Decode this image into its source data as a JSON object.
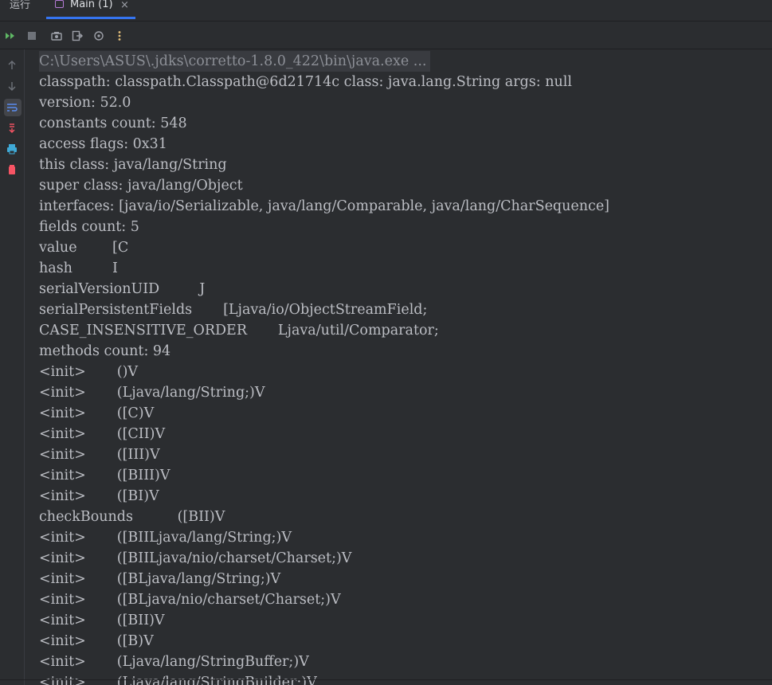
{
  "tabs": {
    "run_label": "运行",
    "main_label": "Main (1)",
    "close_glyph": "×"
  },
  "toolbar": {
    "icons": [
      "rerun-icon",
      "stop-icon",
      "camera-icon",
      "exit-icon",
      "settings-icon",
      "more-icon"
    ]
  },
  "gutter": {
    "icons": [
      "arrow-up-icon",
      "arrow-down-icon",
      "soft-wrap-icon",
      "scroll-to-end-icon",
      "print-icon",
      "trash-icon"
    ]
  },
  "console": {
    "command": "C:\\Users\\ASUS\\.jdks\\corretto-1.8.0_422\\bin\\java.exe ...",
    "lines": [
      "classpath: classpath.Classpath@6d21714c class: java.lang.String args: null",
      "version: 52.0",
      "constants count: 548",
      "access flags: 0x31",
      "this class: java/lang/String",
      "super class: java/lang/Object",
      "interfaces: [java/io/Serializable, java/lang/Comparable, java/lang/CharSequence]",
      "fields count: 5",
      "value        [C",
      "hash         I",
      "serialVersionUID         J",
      "serialPersistentFields       [Ljava/io/ObjectStreamField;",
      "CASE_INSENSITIVE_ORDER       Ljava/util/Comparator;",
      "methods count: 94",
      "<init>       ()V",
      "<init>       (Ljava/lang/String;)V",
      "<init>       ([C)V",
      "<init>       ([CII)V",
      "<init>       ([III)V",
      "<init>       ([BIII)V",
      "<init>       ([BI)V",
      "checkBounds          ([BII)V",
      "<init>       ([BIILjava/lang/String;)V",
      "<init>       ([BIILjava/nio/charset/Charset;)V",
      "<init>       ([BLjava/lang/String;)V",
      "<init>       ([BLjava/nio/charset/Charset;)V",
      "<init>       ([BII)V",
      "<init>       ([B)V",
      "<init>       (Ljava/lang/StringBuffer;)V",
      "<init>       (Ljava/lang/StringBuilder;)V"
    ]
  },
  "colors": {
    "background": "#2b2d30",
    "text": "#bcbec4",
    "accent": "#3574f0",
    "rerun_green": "#5fb865",
    "danger_red": "#f75464",
    "print_blue": "#3fa9d6",
    "more_yellow": "#e5c07b"
  }
}
